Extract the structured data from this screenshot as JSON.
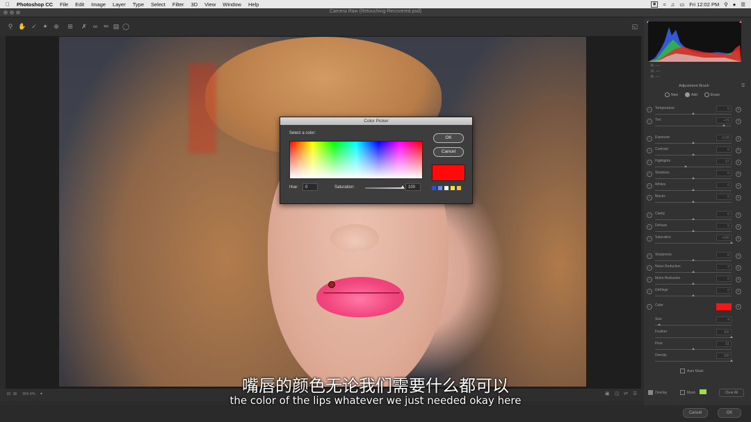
{
  "menubar": {
    "app_name": "Photoshop CC",
    "items": [
      "File",
      "Edit",
      "Image",
      "Layer",
      "Type",
      "Select",
      "Filter",
      "3D",
      "View",
      "Window",
      "Help"
    ],
    "clock": "Fri 12:02 PM"
  },
  "window": {
    "title": "Camera Raw (Retouching-Recovered.psd)"
  },
  "color_picker": {
    "title": "Color Picker",
    "prompt": "Select a color:",
    "ok_label": "OK",
    "cancel_label": "Cancel",
    "hue_label": "Hue:",
    "hue_value": "0",
    "saturation_label": "Saturation:",
    "saturation_value": "100",
    "saturation_level": 100,
    "selected_color": "#ff0a0a",
    "swatches": [
      "#2d4fe0",
      "#6a8cff",
      "#f2f2f2",
      "#f4e03a",
      "#f4c430"
    ]
  },
  "panel": {
    "rgb_readout": [
      "R: ----",
      "G: ----",
      "B: ----"
    ],
    "title": "Adjustment Brush",
    "modes": [
      "New",
      "Add",
      "Erase"
    ],
    "sliders": [
      {
        "label": "Temperature",
        "value": "0"
      },
      {
        "label": "Tint",
        "value": "+76"
      },
      {
        "label": "Exposure",
        "value": "-0.05"
      },
      {
        "label": "Contrast",
        "value": "0"
      },
      {
        "label": "Highlights",
        "value": "-37"
      },
      {
        "label": "Shadows",
        "value": "0"
      },
      {
        "label": "Whites",
        "value": "0"
      },
      {
        "label": "Blacks",
        "value": "0"
      },
      {
        "label": "Clarity",
        "value": "0"
      },
      {
        "label": "Dehaze",
        "value": "0"
      },
      {
        "label": "Saturation",
        "value": "+100"
      },
      {
        "label": "Sharpness",
        "value": "0"
      },
      {
        "label": "Noise Reduction",
        "value": "0"
      },
      {
        "label": "Moire Reduction",
        "value": "0"
      },
      {
        "label": "Defringe",
        "value": "0"
      }
    ],
    "color_label": "Color",
    "color_value": "#f01818",
    "brush": [
      {
        "label": "Size",
        "value": "4"
      },
      {
        "label": "Feather",
        "value": "100"
      },
      {
        "label": "Flow",
        "value": "51"
      },
      {
        "label": "Density",
        "value": "100"
      }
    ],
    "auto_mask_label": "Auto Mask",
    "overlay_label": "Overlay",
    "mask_label": "Mask",
    "mask_color": "#9be04a",
    "clear_all_label": "Clear All"
  },
  "bottom": {
    "zoom": "359.4%"
  },
  "footer": {
    "cancel_label": "Cancel",
    "ok_label": "OK"
  },
  "subtitles": {
    "chinese": "嘴唇的颜色无论我们需要什么都可以",
    "english": "the color of the lips whatever we just needed okay here"
  }
}
